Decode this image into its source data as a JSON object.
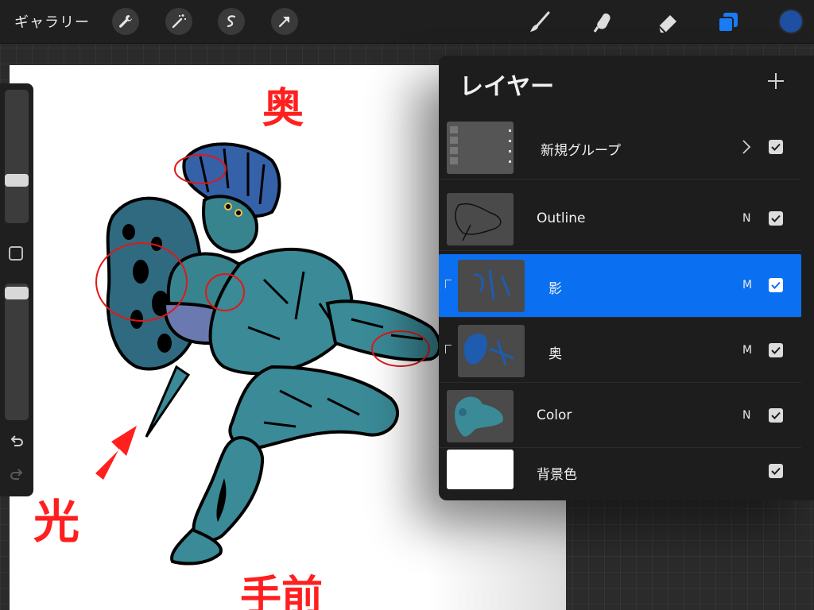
{
  "toolbar": {
    "gallery_label": "ギャラリー",
    "left_tools": [
      "wrench-icon",
      "magic-wand-icon",
      "selection-icon",
      "transform-arrow-icon"
    ],
    "right_tools": [
      "brush-icon",
      "smudge-icon",
      "eraser-icon",
      "layers-icon"
    ],
    "current_color": "#1e4fa0",
    "active_tool_color": "#1a7cf5"
  },
  "canvas": {
    "annotations": {
      "top": "奥",
      "bottom": "手前",
      "light": "光"
    },
    "annotation_color": "#ff1f1f"
  },
  "layers_panel": {
    "title": "レイヤー",
    "add_icon": "plus-icon",
    "layers": [
      {
        "name": "新規グループ",
        "blend": "",
        "checked": true,
        "type": "group"
      },
      {
        "name": "Outline",
        "blend": "N",
        "checked": true
      },
      {
        "name": "影",
        "blend": "M",
        "checked": true,
        "active": true,
        "clipped": true
      },
      {
        "name": "奥",
        "blend": "M",
        "checked": true,
        "clipped": true
      },
      {
        "name": "Color",
        "blend": "N",
        "checked": true
      },
      {
        "name": "背景色",
        "blend": "",
        "checked": true
      }
    ],
    "active_color": "#0a6ff0"
  }
}
